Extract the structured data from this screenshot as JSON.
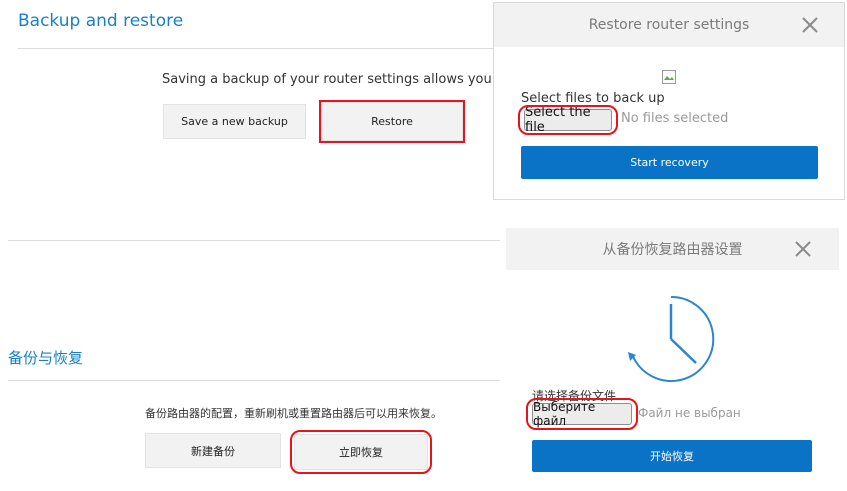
{
  "en": {
    "section_title": "Backup and restore",
    "description": "Saving a backup of your router settings allows you to re",
    "save_backup_label": "Save a new backup",
    "restore_label": "Restore"
  },
  "en_modal": {
    "title": "Restore router settings",
    "select_label": "Select files to back up",
    "file_button": "Select the file",
    "file_status": "No files selected",
    "start_button": "Start recovery",
    "icons": {
      "close": "close-icon",
      "image": "broken-image-icon"
    }
  },
  "zh": {
    "section_title": "备份与恢复",
    "description": "备份路由器的配置，重新刷机或重置路由器后可以用来恢复。",
    "save_backup_label": "新建备份",
    "restore_label": "立即恢复"
  },
  "zh_modal": {
    "title": "从备份恢复路由器设置",
    "select_label": "请选择备份文件",
    "file_button": "Выберите файл",
    "file_status": "Файл не выбран",
    "start_button": "开始恢复",
    "icons": {
      "close": "close-icon",
      "clock": "clock-icon"
    }
  },
  "colors": {
    "accent": "#1a7fc4",
    "button_blue": "#0a73c5",
    "highlight_red": "#e8141b"
  }
}
